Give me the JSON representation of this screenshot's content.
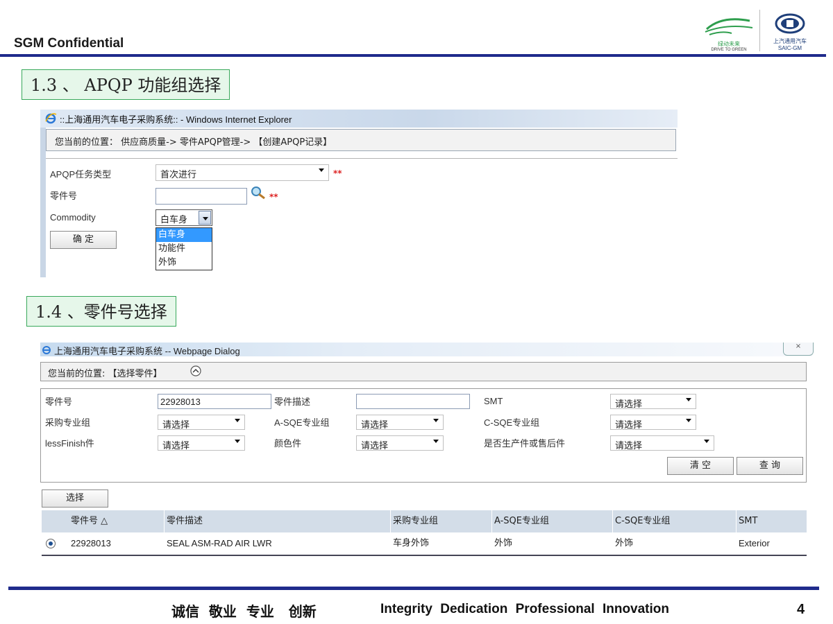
{
  "header": {
    "confidential": "SGM Confidential",
    "logo_left_text_cn": "绿动未来",
    "logo_left_text_en": "DRIVE TO GREEN",
    "logo_right_text_cn": "上汽通用汽车",
    "logo_right_text_en": "SAIC-GM"
  },
  "section1": {
    "title": "1.3 、 APQP 功能组选择",
    "window_title": "::上海通用汽车电子采购系统:: - Windows Internet Explorer",
    "breadcrumb": "您当前的位置： 供应商质量-> 零件APQP管理-> 【创建APQP记录】",
    "fields": {
      "task_type_label": "APQP任务类型",
      "task_type_value": "首次进行",
      "part_no_label": "零件号",
      "part_no_value": "",
      "commodity_label": "Commodity",
      "commodity_value": "白车身",
      "required_mark": "**"
    },
    "commodity_options": [
      "白车身",
      "功能件",
      "外饰"
    ],
    "confirm_button": "确 定"
  },
  "section2": {
    "title": "1.4 、零件号选择",
    "window_title": "上海通用汽车电子采购系统 -- Webpage Dialog",
    "breadcrumb": "您当前的位置: 【选择零件】",
    "form": {
      "part_no_label": "零件号",
      "part_no_value": "22928013",
      "part_desc_label": "零件描述",
      "part_desc_value": "",
      "smt_label": "SMT",
      "smt_value": "请选择",
      "purchase_group_label": "采购专业组",
      "purchase_group_value": "请选择",
      "asqe_label": "A-SQE专业组",
      "asqe_value": "请选择",
      "csqe_label": "C-SQE专业组",
      "csqe_value": "请选择",
      "lessfinish_label": "lessFinish件",
      "lessfinish_value": "请选择",
      "color_label": "颜色件",
      "color_value": "请选择",
      "aftersale_label": "是否生产件或售后件",
      "aftersale_value": "请选择"
    },
    "clear_button": "清 空",
    "query_button": "查 询",
    "select_button": "选择",
    "table": {
      "headers": [
        "零件号 △",
        "零件描述",
        "采购专业组",
        "A-SQE专业组",
        "C-SQE专业组",
        "SMT"
      ],
      "rows": [
        {
          "part_no": "22928013",
          "desc": "SEAL ASM-RAD AIR LWR",
          "purchase": "车身外饰",
          "asqe": "外饰",
          "csqe": "外饰",
          "smt": "Exterior",
          "selected": true
        }
      ]
    }
  },
  "footer": {
    "values_cn": "诚信  敬业  专业   创新",
    "values_en": "Integrity Dedication Professional Innovation",
    "page_number": "4"
  }
}
